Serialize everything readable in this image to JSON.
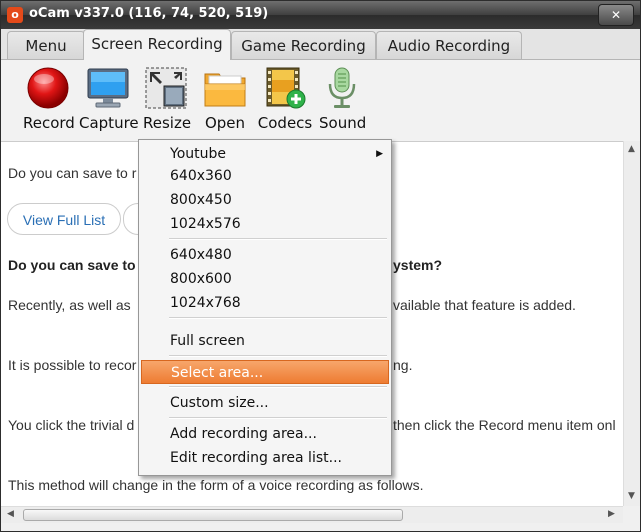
{
  "window": {
    "title": "oCam v337.0 (116, 74, 520, 519)",
    "close": "✕",
    "app_icon": "o"
  },
  "tabs": [
    {
      "label": "Menu"
    },
    {
      "label": "Screen Recording",
      "active": true
    },
    {
      "label": "Game Recording"
    },
    {
      "label": "Audio Recording"
    }
  ],
  "toolbar": [
    {
      "label": "Record",
      "icon": "record-icon"
    },
    {
      "label": "Capture",
      "icon": "monitor-icon"
    },
    {
      "label": "Resize",
      "icon": "resize-icon"
    },
    {
      "label": "Open",
      "icon": "folder-icon"
    },
    {
      "label": "Codecs",
      "icon": "film-icon"
    },
    {
      "label": "Sound",
      "icon": "microphone-icon"
    }
  ],
  "content": {
    "link_line": "Do you can save to r",
    "buttons": [
      "View Full List",
      ""
    ],
    "heading_left": "Do you can save to",
    "heading_right": "ystem?",
    "para1_left": "Recently, as well as",
    "para1_right": "vailable that feature is added.",
    "para2_left": "It is possible to recor",
    "para2_right": "ng.",
    "para3_left": "You click the trivial d",
    "para3_right": "then click the Record menu item onl",
    "para4": "This method will change in the form of a voice recording as follows."
  },
  "menu": {
    "items": [
      {
        "label": "Youtube",
        "submenu": true
      },
      {
        "label": "640x360"
      },
      {
        "label": "800x450"
      },
      {
        "label": "1024x576"
      },
      {
        "label": "640x480"
      },
      {
        "label": "800x600"
      },
      {
        "label": "1024x768"
      },
      {
        "label": "Full screen"
      },
      {
        "label": "Select area...",
        "selected": true
      },
      {
        "label": "Custom size..."
      },
      {
        "label": "Add recording area..."
      },
      {
        "label": "Edit recording area list..."
      }
    ]
  },
  "colors": {
    "accent": "#ee7c32",
    "link": "#2a6fb5",
    "title_bar": "#3a3a3a"
  }
}
